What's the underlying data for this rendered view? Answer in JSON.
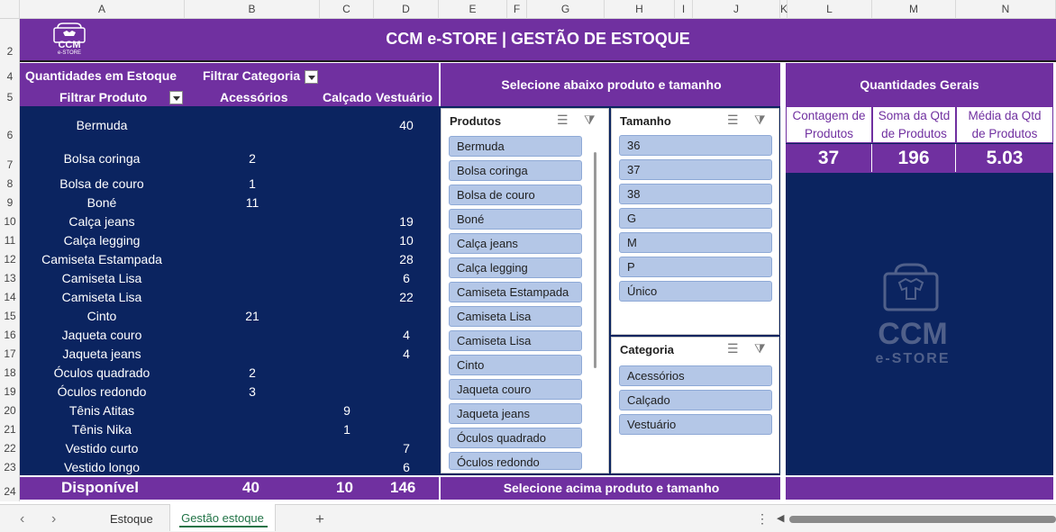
{
  "columns": [
    "A",
    "B",
    "C",
    "D",
    "E",
    "F",
    "G",
    "H",
    "I",
    "J",
    "K",
    "L",
    "M",
    "N"
  ],
  "rows": [
    "2",
    "4",
    "5",
    "6",
    "7",
    "8",
    "9",
    "10",
    "11",
    "12",
    "13",
    "14",
    "15",
    "16",
    "17",
    "18",
    "19",
    "20",
    "21",
    "22",
    "23",
    "24"
  ],
  "title": "CCM e-STORE | GESTÃO DE ESTOQUE",
  "logo_text_small": "CCM",
  "logo_sub_small": "e-STORE",
  "pivot": {
    "header_qty": "Quantidades em Estoque",
    "header_filter_category": "Filtrar Categoria",
    "header_filter_product": "Filtrar Produto",
    "col_acessorios": "Acessórios",
    "col_calcado": "Calçado",
    "col_vestuario": "Vestuário",
    "items": [
      {
        "name": "Bermuda",
        "b": "",
        "c": "",
        "d": "40"
      },
      {
        "name": "Bolsa coringa",
        "b": "2",
        "c": "",
        "d": ""
      },
      {
        "name": "Bolsa de couro",
        "b": "1",
        "c": "",
        "d": ""
      },
      {
        "name": "Boné",
        "b": "11",
        "c": "",
        "d": ""
      },
      {
        "name": "Calça jeans",
        "b": "",
        "c": "",
        "d": "19"
      },
      {
        "name": "Calça legging",
        "b": "",
        "c": "",
        "d": "10"
      },
      {
        "name": "Camiseta Estampada",
        "b": "",
        "c": "",
        "d": "28"
      },
      {
        "name": "Camiseta Lisa",
        "b": "",
        "c": "",
        "d": "6"
      },
      {
        "name": "Camiseta Lisa",
        "b": "",
        "c": "",
        "d": "22"
      },
      {
        "name": "Cinto",
        "b": "21",
        "c": "",
        "d": ""
      },
      {
        "name": "Jaqueta couro",
        "b": "",
        "c": "",
        "d": "4"
      },
      {
        "name": "Jaqueta jeans",
        "b": "",
        "c": "",
        "d": "4"
      },
      {
        "name": "Óculos quadrado",
        "b": "2",
        "c": "",
        "d": ""
      },
      {
        "name": "Óculos redondo",
        "b": "3",
        "c": "",
        "d": ""
      },
      {
        "name": "Tênis Atitas",
        "b": "",
        "c": "9",
        "d": ""
      },
      {
        "name": "Tênis Nika",
        "b": "",
        "c": "1",
        "d": ""
      },
      {
        "name": "Vestido curto",
        "b": "",
        "c": "",
        "d": "7"
      },
      {
        "name": "Vestido longo",
        "b": "",
        "c": "",
        "d": "6"
      }
    ],
    "total_label": "Disponível",
    "total_b": "40",
    "total_c": "10",
    "total_d": "146"
  },
  "select_header": "Selecione abaixo produto e tamanho",
  "select_footer": "Selecione acima produto e tamanho",
  "slicer_produtos": {
    "title": "Produtos",
    "items": [
      "Bermuda",
      "Bolsa coringa",
      "Bolsa de couro",
      "Boné",
      "Calça jeans",
      "Calça legging",
      "Camiseta Estampada",
      "Camiseta Lisa",
      "Camiseta Lisa",
      "Cinto",
      "Jaqueta couro",
      "Jaqueta jeans",
      "Óculos quadrado",
      "Óculos redondo"
    ]
  },
  "slicer_tamanho": {
    "title": "Tamanho",
    "items": [
      "36",
      "37",
      "38",
      "G",
      "M",
      "P",
      "Único"
    ]
  },
  "slicer_categoria": {
    "title": "Categoria",
    "items": [
      "Acessórios",
      "Calçado",
      "Vestuário"
    ]
  },
  "stats": {
    "header": "Quantidades Gerais",
    "label_count_1": "Contagem de",
    "label_count_2": "Produtos",
    "label_sum_1": "Soma da Qtd",
    "label_sum_2": "de Produtos",
    "label_avg_1": "Média da Qtd",
    "label_avg_2": "de Produtos",
    "count": "37",
    "sum": "196",
    "avg": "5.03"
  },
  "watermark_text": "CCM",
  "watermark_sub": "e-STORE",
  "tabs": {
    "estoque": "Estoque",
    "gestao": "Gestão estoque",
    "add": "+"
  },
  "colors": {
    "purple": "#7030a0",
    "navy": "#0b2460",
    "slicer_button": "#b4c7e7",
    "active_tab_underline": "#217346"
  }
}
